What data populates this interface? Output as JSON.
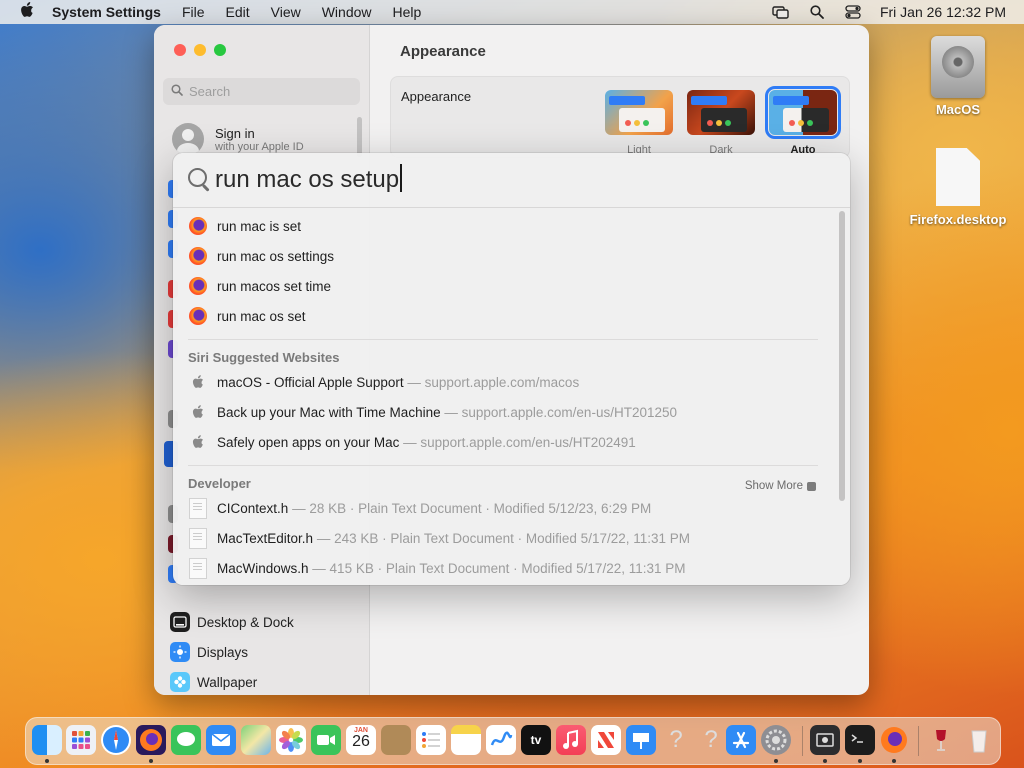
{
  "menubar": {
    "app_name": "System Settings",
    "menus": [
      "File",
      "Edit",
      "View",
      "Window",
      "Help"
    ],
    "clock": "Fri Jan 26  12:32 PM"
  },
  "desktop": {
    "disk_label": "MacOS",
    "file_label": "Firefox.desktop"
  },
  "sidebar": {
    "search_placeholder": "Search",
    "signin_title": "Sign in",
    "signin_subtitle": "with your Apple ID",
    "items": [
      {
        "label": "Desktop & Dock",
        "icon": "dock-icon",
        "color": "#1f1f1f"
      },
      {
        "label": "Displays",
        "icon": "displays-icon",
        "color": "#2f8bf5"
      },
      {
        "label": "Wallpaper",
        "icon": "wallpaper-icon",
        "color": "#5ac8fa"
      }
    ]
  },
  "main": {
    "title": "Appearance",
    "row_label": "Appearance",
    "options": [
      {
        "label": "Light",
        "selected": false
      },
      {
        "label": "Dark",
        "selected": false
      },
      {
        "label": "Auto",
        "selected": true
      }
    ]
  },
  "spotlight": {
    "query": "run mac os setup",
    "suggestions": [
      "run mac is set",
      "run mac os settings",
      "run macos set time",
      "run mac os set"
    ],
    "websites_header": "Siri Suggested Websites",
    "websites": [
      {
        "title": "macOS - Official Apple Support",
        "url": "— support.apple.com/macos"
      },
      {
        "title": "Back up your Mac with Time Machine",
        "url": "— support.apple.com/en-us/HT201250"
      },
      {
        "title": "Safely open apps on your Mac",
        "url": "— support.apple.com/en-us/HT202491"
      }
    ],
    "developer_header": "Developer",
    "show_more": "Show More",
    "files": [
      {
        "name": "CIContext.h",
        "meta": "— 28 KB · Plain Text Document · Modified 5/12/23, 6:29 PM"
      },
      {
        "name": "MacTextEditor.h",
        "meta": "— 243 KB · Plain Text Document · Modified 5/17/22, 11:31 PM"
      },
      {
        "name": "MacWindows.h",
        "meta": "— 415 KB · Plain Text Document · Modified 5/17/22, 11:31 PM"
      }
    ]
  },
  "dock": {
    "calendar_month": "JAN",
    "calendar_day": "26",
    "tv_label": "tv",
    "apps": [
      "finder",
      "launchpad",
      "safari",
      "firefox",
      "messages",
      "mail",
      "maps",
      "photos",
      "facetime",
      "calendar",
      "contacts",
      "reminders",
      "notes",
      "freeform",
      "tv",
      "music",
      "news",
      "keynote",
      "unknown",
      "unknown",
      "app-store",
      "system-settings",
      "screenshot",
      "terminal",
      "firefox",
      "wine",
      "trash"
    ]
  }
}
